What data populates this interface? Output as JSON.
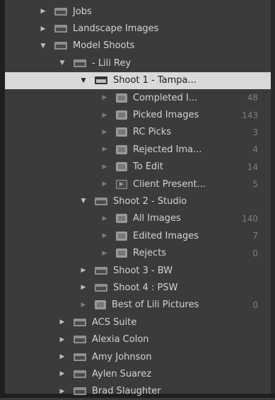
{
  "tree": [
    {
      "label": "Jobs",
      "indent": 0,
      "tri": "right",
      "icon": "set",
      "count": ""
    },
    {
      "label": "Landscape Images",
      "indent": 0,
      "tri": "right",
      "icon": "set",
      "count": ""
    },
    {
      "label": "Model Shoots",
      "indent": 0,
      "tri": "down",
      "icon": "set",
      "count": ""
    },
    {
      "label": "- Lili Rey",
      "indent": 1,
      "tri": "down",
      "icon": "set",
      "count": ""
    },
    {
      "label": "Shoot 1 - Tampa...",
      "indent": 2,
      "tri": "down",
      "icon": "set",
      "count": "",
      "selected": true
    },
    {
      "label": "Completed I...",
      "indent": 3,
      "tri": "faint",
      "icon": "coll",
      "count": "48"
    },
    {
      "label": "Picked Images",
      "indent": 3,
      "tri": "faint",
      "icon": "coll",
      "count": "143"
    },
    {
      "label": "RC Picks",
      "indent": 3,
      "tri": "faint",
      "icon": "coll",
      "count": "3"
    },
    {
      "label": "Rejected Ima...",
      "indent": 3,
      "tri": "faint",
      "icon": "coll",
      "count": "4"
    },
    {
      "label": "To Edit",
      "indent": 3,
      "tri": "faint",
      "icon": "coll",
      "count": "14"
    },
    {
      "label": "Client Present...",
      "indent": 3,
      "tri": "faint",
      "icon": "smart",
      "count": "5"
    },
    {
      "label": "Shoot 2 - Studio",
      "indent": 2,
      "tri": "down",
      "icon": "set",
      "count": ""
    },
    {
      "label": "All Images",
      "indent": 3,
      "tri": "faint",
      "icon": "coll",
      "count": "140"
    },
    {
      "label": "Edited Images",
      "indent": 3,
      "tri": "faint",
      "icon": "coll",
      "count": "7"
    },
    {
      "label": "Rejects",
      "indent": 3,
      "tri": "faint",
      "icon": "coll",
      "count": "0"
    },
    {
      "label": "Shoot 3 - BW",
      "indent": 2,
      "tri": "right",
      "icon": "set",
      "count": ""
    },
    {
      "label": "Shoot 4 : PSW",
      "indent": 2,
      "tri": "right",
      "icon": "set",
      "count": ""
    },
    {
      "label": "Best of Lili Pictures",
      "indent": 2,
      "tri": "faint",
      "icon": "coll",
      "count": "0"
    },
    {
      "label": "ACS Suite",
      "indent": 1,
      "tri": "right",
      "icon": "set",
      "count": ""
    },
    {
      "label": "Alexia Colon",
      "indent": 1,
      "tri": "right",
      "icon": "set",
      "count": ""
    },
    {
      "label": "Amy Johnson",
      "indent": 1,
      "tri": "right",
      "icon": "set",
      "count": ""
    },
    {
      "label": "Aylen Suarez",
      "indent": 1,
      "tri": "right",
      "icon": "set",
      "count": ""
    },
    {
      "label": "Brad Slaughter",
      "indent": 1,
      "tri": "right",
      "icon": "set",
      "count": ""
    }
  ],
  "glyphs": {
    "right": "▶",
    "down": "▼",
    "faint": "▶"
  }
}
